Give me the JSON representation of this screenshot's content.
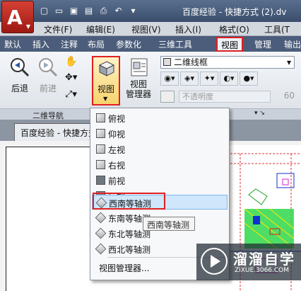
{
  "title_bar": {
    "title": "百度经验 - 快捷方式 (2).dv",
    "quick_access_icons": [
      "new-icon",
      "open-icon",
      "save-icon",
      "saveas-icon",
      "print-icon",
      "undo-icon",
      "redo-icon"
    ]
  },
  "menu_bar": {
    "items": [
      "文件(F)",
      "编辑(E)",
      "视图(V)",
      "插入(I)",
      "格式(O)",
      "工具(T"
    ]
  },
  "ribbon_tabs": {
    "items": [
      "默认",
      "插入",
      "注释",
      "布局",
      "参数化",
      "三维工具",
      "视图",
      "管理",
      "输出"
    ],
    "active": "视图"
  },
  "ribbon": {
    "back_label": "后退",
    "forward_label": "前进",
    "view_label": "视图",
    "view_manager_label": "视图\n管理器",
    "view_manager_line1": "视图",
    "view_manager_line2": "管理器",
    "visual_style": "二维线框",
    "opacity_label": "不透明度",
    "opacity_value": "60",
    "group_nav_label": "二维导航"
  },
  "doc_tab": {
    "label": "百度经验 - 快捷方式"
  },
  "view_menu": {
    "items": [
      {
        "label": "俯视",
        "icon": "top-view-icon"
      },
      {
        "label": "仰视",
        "icon": "bottom-view-icon"
      },
      {
        "label": "左视",
        "icon": "left-view-icon"
      },
      {
        "label": "右视",
        "icon": "right-view-icon"
      },
      {
        "label": "前视",
        "icon": "front-view-icon"
      },
      {
        "label": "后视",
        "icon": "back-view-icon"
      },
      {
        "label": "西南等轴测",
        "icon": "sw-iso-icon"
      },
      {
        "label": "东南等轴测",
        "icon": "se-iso-icon"
      },
      {
        "label": "东北等轴测",
        "icon": "ne-iso-icon"
      },
      {
        "label": "西北等轴测",
        "icon": "nw-iso-icon"
      }
    ],
    "manager_label": "视图管理器...",
    "highlighted": "西南等轴测"
  },
  "tooltip": "西南等轴测",
  "watermark": {
    "title": "溜溜自学",
    "url": "ZIXUE.3066.COM"
  },
  "colors": {
    "highlight_border": "#e02020",
    "tab_bar": "#4b5d7a",
    "menu_highlight": "#cfe6fb"
  }
}
